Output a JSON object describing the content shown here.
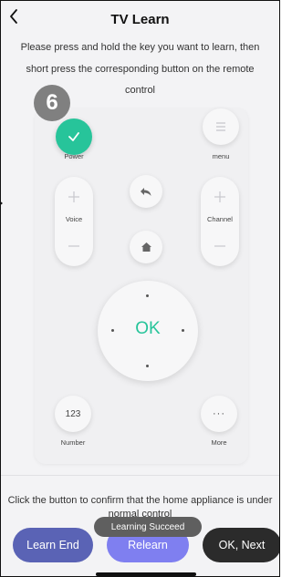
{
  "header": {
    "title": "TV Learn",
    "back_icon": "chevron-left-icon",
    "instruction": "Please press and hold the key you want to learn, then short press the corresponding button on the remote control"
  },
  "step_badge": "6",
  "remote": {
    "power_label": "Power",
    "menu_label": "menu",
    "voice_label": "Voice",
    "channel_label": "Channel",
    "ok_label": "OK",
    "number_button": "123",
    "number_label": "Number",
    "more_button": "···",
    "more_label": "More"
  },
  "footer": {
    "confirm_text": "Click the button to confirm that the home appliance is under normal control",
    "toast": "Learning Succeed",
    "learn_end": "Learn End",
    "relearn": "Relearn",
    "ok_next": "OK, Next"
  },
  "colors": {
    "accent_green": "#27c49a",
    "learn_end_bg": "#5a63b5",
    "relearn_bg": "#7f7ff0",
    "ok_next_bg": "#2b2b2b"
  }
}
